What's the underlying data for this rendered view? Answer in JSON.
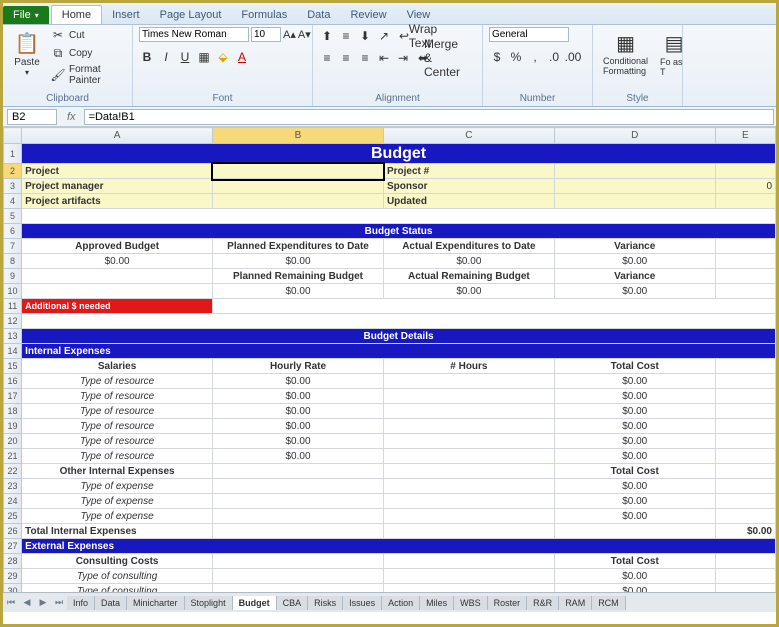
{
  "tabs": {
    "file": "File",
    "list": [
      "Home",
      "Insert",
      "Page Layout",
      "Formulas",
      "Data",
      "Review",
      "View"
    ],
    "activeIndex": 0
  },
  "ribbon": {
    "clipboard": {
      "label": "Clipboard",
      "paste": "Paste",
      "cut": "Cut",
      "copy": "Copy",
      "fmtpaint": "Format Painter"
    },
    "font": {
      "label": "Font",
      "name": "Times New Roman",
      "size": "10"
    },
    "alignment": {
      "label": "Alignment",
      "wrap": "Wrap Text",
      "merge": "Merge & Center"
    },
    "number": {
      "label": "Number",
      "format": "General"
    },
    "styles": {
      "label": "Style",
      "cond": "Conditional Formatting",
      "fmt": "Fo as T"
    }
  },
  "formula": {
    "cellref": "B2",
    "value": "=Data!B1"
  },
  "cols": [
    "",
    "A",
    "B",
    "C",
    "D",
    "E"
  ],
  "rows": {
    "title": "Budget",
    "r2": {
      "a": "Project",
      "c": "Project #"
    },
    "r3": {
      "a": "Project manager",
      "c": "Sponsor",
      "e": "0"
    },
    "r4": {
      "a": "Project artifacts",
      "c": "Updated"
    },
    "r6": "Budget Status",
    "r7": {
      "a": "Approved Budget",
      "b": "Planned Expenditures to Date",
      "c": "Actual Expenditures to Date",
      "d": "Variance"
    },
    "r8": {
      "a": "$0.00",
      "b": "$0.00",
      "c": "$0.00",
      "d": "$0.00"
    },
    "r9": {
      "b": "Planned Remaining Budget",
      "c": "Actual Remaining Budget",
      "d": "Variance"
    },
    "r10": {
      "b": "$0.00",
      "c": "$0.00",
      "d": "$0.00"
    },
    "r11": "Additional $ needed",
    "r13": "Budget Details",
    "r14": "Internal Expenses",
    "r15": {
      "a": "Salaries",
      "b": "Hourly Rate",
      "c": "# Hours",
      "d": "Total Cost"
    },
    "typeRes": "Type of resource",
    "zero": "$0.00",
    "r22": {
      "a": "Other Internal Expenses",
      "d": "Total Cost"
    },
    "typeExp": "Type of expense",
    "r26": {
      "a": "Total Internal Expenses",
      "e": "$0.00"
    },
    "r27": "External Expenses",
    "r28": {
      "a": "Consulting Costs",
      "d": "Total Cost"
    },
    "typeCon": "Type of consulting"
  },
  "sheets": {
    "active": "Budget",
    "list": [
      "Info",
      "Data",
      "Minicharter",
      "Stoplight",
      "Budget",
      "CBA",
      "Risks",
      "Issues",
      "Action",
      "Miles",
      "WBS",
      "Roster",
      "R&R",
      "RAM",
      "RCM"
    ]
  }
}
